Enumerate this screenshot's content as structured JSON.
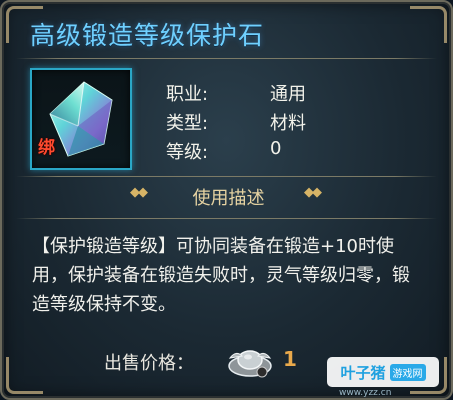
{
  "item": {
    "name": "高级锻造等级保护石",
    "bind_mark": "绑",
    "attributes": [
      {
        "label": "职业:",
        "value": "通用"
      },
      {
        "label": "类型:",
        "value": "材料"
      },
      {
        "label": "等级:",
        "value": "0"
      }
    ]
  },
  "description": {
    "section_title": "使用描述",
    "text": "【保护锻造等级】可协同装备在锻造+10时使用，保护装备在锻造失败时，灵气等级归零，锻造等级保持不变。"
  },
  "price": {
    "label": "出售价格：",
    "value": "1",
    "currency_icon": "silver-ingot-icon"
  },
  "watermark": {
    "name": "叶子猪",
    "tag": "游戏网",
    "url": "www.yzz.cn"
  },
  "colors": {
    "title": "#6fd0ff",
    "frame": "#2aa7c6",
    "bind": "#ff4a2e",
    "price": "#e9a94b"
  }
}
